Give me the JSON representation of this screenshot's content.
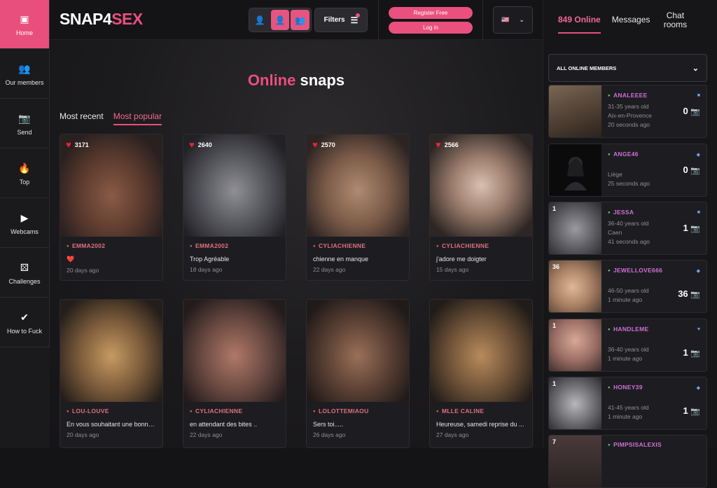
{
  "sidebar": {
    "items": [
      {
        "label": "Home",
        "icon": "picture-icon",
        "glyph": "▣"
      },
      {
        "label": "Our members",
        "icon": "members-icon",
        "glyph": "👥"
      },
      {
        "label": "Send",
        "icon": "camera-icon",
        "glyph": "📷"
      },
      {
        "label": "Top",
        "icon": "flame-icon",
        "glyph": "🔥"
      },
      {
        "label": "Webcams",
        "icon": "video-icon",
        "glyph": "▶"
      },
      {
        "label": "Challenges",
        "icon": "dice-icon",
        "glyph": "⚄"
      },
      {
        "label": "How to Fuck",
        "icon": "check-icon",
        "glyph": "✔"
      }
    ]
  },
  "header": {
    "logo_part1": "SNAP4",
    "logo_part2": "SEX",
    "filters_label": "Filters",
    "register_label": "Register Free",
    "login_label": "Log in",
    "lang_flag": "🇺🇸"
  },
  "main": {
    "title_part1": "Online",
    "title_part2": "snaps",
    "tabs": [
      {
        "label": "Most recent"
      },
      {
        "label": "Most popular"
      }
    ],
    "snaps": [
      {
        "likes": "3171",
        "user": "EMMA2002",
        "text": "❤️",
        "ago": "20 days ago"
      },
      {
        "likes": "2640",
        "user": "EMMA2002",
        "text": "Trop Agréable",
        "ago": "18 days ago"
      },
      {
        "likes": "2570",
        "user": "CYLIACHIENNE",
        "text": "chienne en manque",
        "ago": "22 days ago"
      },
      {
        "likes": "2566",
        "user": "CYLIACHIENNE",
        "text": "j'adore me doigter",
        "ago": "15 days ago"
      },
      {
        "likes": "",
        "user": "LOU-LOUVE",
        "text": "En vous souhaitant une bonne...",
        "ago": "20 days ago"
      },
      {
        "likes": "",
        "user": "CYLIACHIENNE",
        "text": "en attendant des bites ..",
        "ago": "22 days ago"
      },
      {
        "likes": "",
        "user": "LOLOTTEMIAOU",
        "text": "Sers toi.....",
        "ago": "26 days ago"
      },
      {
        "likes": "",
        "user": "MLLE CALINE",
        "text": "Heureuse, samedi reprise du ...",
        "ago": "27 days ago"
      }
    ]
  },
  "right": {
    "tabs": [
      {
        "label": "849 Online"
      },
      {
        "label": "Messages"
      },
      {
        "label": "Chat rooms"
      }
    ],
    "dropdown_label": "ALL ONLINE MEMBERS",
    "members": [
      {
        "name": "ANALEEEE",
        "age": "31-35 years old",
        "city": "Aix-en-Provence",
        "ago": "20 seconds ago",
        "snaps": "0",
        "count": ""
      },
      {
        "name": "ANGE46",
        "age": "",
        "city": "Liège",
        "ago": "25 seconds ago",
        "snaps": "0",
        "count": ""
      },
      {
        "name": "JESSA",
        "age": "36-40 years old",
        "city": "Caen",
        "ago": "41 seconds ago",
        "snaps": "1",
        "count": "1"
      },
      {
        "name": "JEWELLOVE666",
        "age": "46-50 years old",
        "city": "",
        "ago": "1 minute ago",
        "snaps": "36",
        "count": "36"
      },
      {
        "name": "HANDLEME",
        "age": "36-40 years old",
        "city": "",
        "ago": "1 minute ago",
        "snaps": "1",
        "count": "1"
      },
      {
        "name": "HONEY39",
        "age": "41-45 years old",
        "city": "",
        "ago": "1 minute ago",
        "snaps": "1",
        "count": "1"
      },
      {
        "name": "PIMPSISALEXIS",
        "age": "",
        "city": "",
        "ago": "",
        "snaps": "",
        "count": "7"
      }
    ]
  }
}
